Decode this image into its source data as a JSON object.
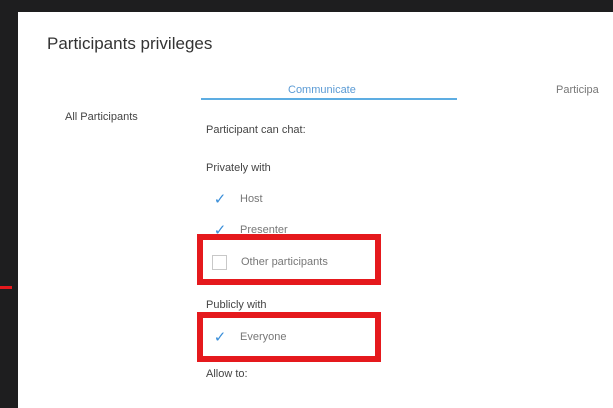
{
  "dialog": {
    "title": "Participants privileges",
    "tabs": [
      {
        "label": "Communicate",
        "active": true
      },
      {
        "label": "Participa",
        "active": false
      }
    ],
    "sidebar": {
      "items": [
        {
          "label": "All Participants"
        }
      ]
    },
    "content": {
      "chat_label": "Participant can chat:",
      "privately_label": "Privately with",
      "privately_options": [
        {
          "label": "Host",
          "checked": true
        },
        {
          "label": "Presenter",
          "checked": true
        },
        {
          "label": "Other participants",
          "checked": false
        }
      ],
      "publicly_label": "Publicly with",
      "publicly_options": [
        {
          "label": "Everyone",
          "checked": true
        }
      ],
      "allow_label": "Allow to:"
    }
  },
  "colors": {
    "accent": "#5dade2",
    "check": "#3b8fd9",
    "highlight": "#e5191d",
    "background": "#1e1e1f"
  }
}
